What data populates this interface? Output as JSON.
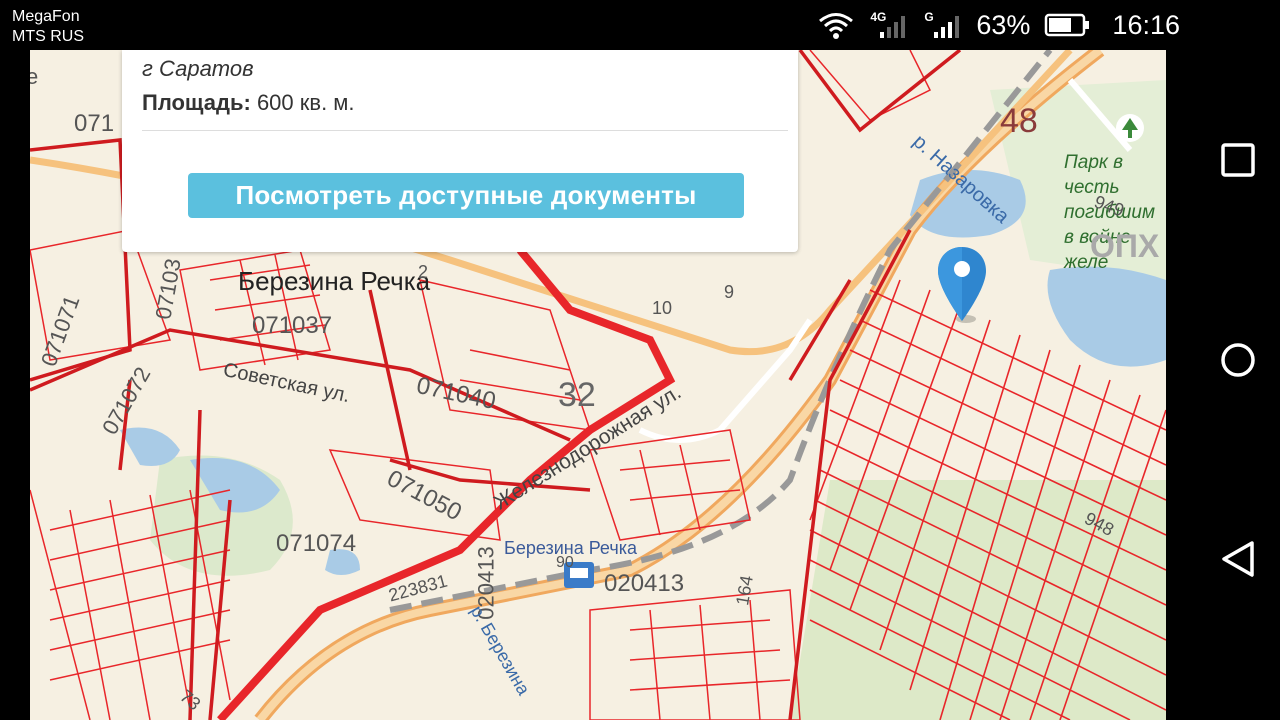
{
  "status_bar": {
    "carrier_1": "MegaFon",
    "carrier_2": "MTS RUS",
    "net_1": "4G",
    "net_2": "G",
    "battery": "63%",
    "time": "16:16"
  },
  "popup": {
    "city": "г Саратов",
    "area_label": "Площадь:",
    "area_value": " 600 кв. м.",
    "button_label": "Посмотреть доступные документы"
  },
  "map": {
    "labels": {
      "village": "Березина Речка",
      "parcel_071037": "071037",
      "parcel_071040": "071040",
      "parcel_071050": "071050",
      "parcel_071074": "071074",
      "parcel_071072": "071072",
      "parcel_071071": "071071",
      "parcel_07103": "07103",
      "parcel_071": "071",
      "num_32": "32",
      "num_48": "48",
      "num_10": "10",
      "num_9": "9",
      "num_2": "2",
      "num_90": "90",
      "num_164": "164",
      "num_948a": "948",
      "num_948b": "949",
      "num_73": "73",
      "street_soviet": "Советская ул.",
      "street_zheleznodor": "Железнодорожная ул.",
      "river": "р. Назаровка",
      "river_2": "р. Березина",
      "station": "Березина Речка",
      "code_223831": "223831",
      "code_020413a": "020413",
      "code_020413b": "020413",
      "park": "Парк в честь погибшим в войне желе",
      "opx": "ОПХ",
      "edge_e": "е"
    },
    "colors": {
      "parcel": "#e8262a",
      "road_main": "#f5b36a",
      "water": "#a9cbe6",
      "green": "#d6e8c8",
      "background": "#f6f0e2"
    }
  }
}
